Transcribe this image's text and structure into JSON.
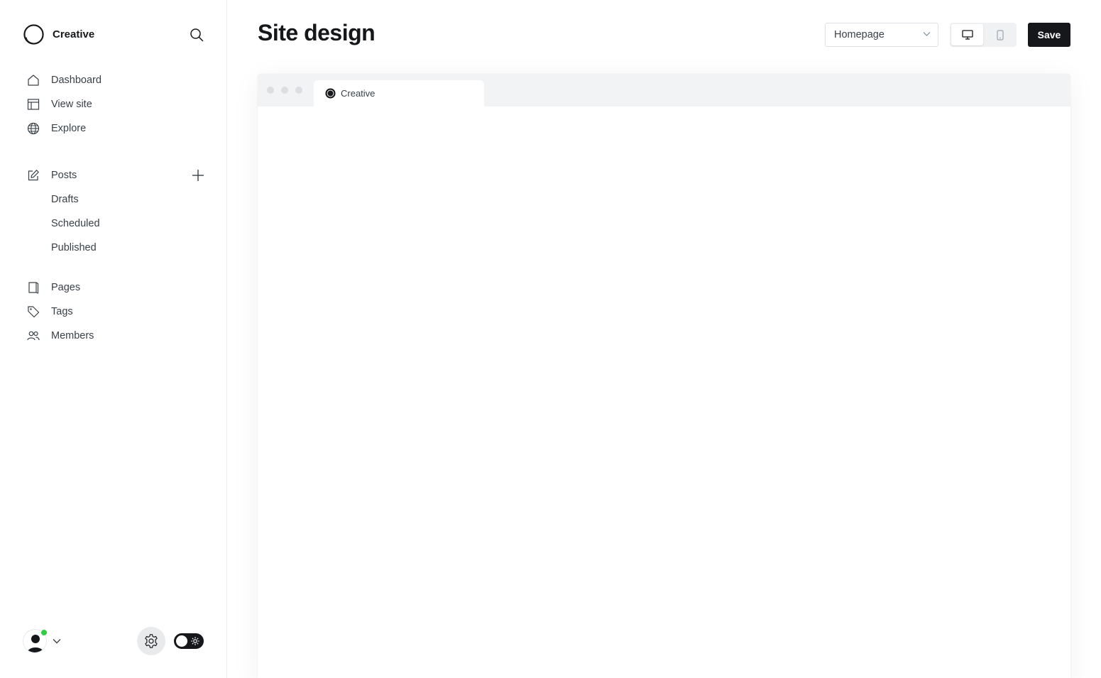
{
  "sidebar": {
    "brand_name": "Creative",
    "primary": [
      {
        "label": "Dashboard",
        "icon": "home-icon"
      },
      {
        "label": "View site",
        "icon": "layout-icon"
      },
      {
        "label": "Explore",
        "icon": "globe-icon"
      }
    ],
    "posts": {
      "label": "Posts",
      "icon": "pencil-square-icon",
      "sub": [
        "Drafts",
        "Scheduled",
        "Published"
      ]
    },
    "secondary": [
      {
        "label": "Pages",
        "icon": "page-icon"
      },
      {
        "label": "Tags",
        "icon": "tag-icon"
      },
      {
        "label": "Members",
        "icon": "members-icon"
      }
    ]
  },
  "main": {
    "title": "Site design",
    "preview_select": {
      "selected": "Homepage"
    },
    "device": {
      "active": "desktop"
    },
    "save_label": "Save"
  },
  "browser": {
    "tab_title": "Creative"
  },
  "colors": {
    "accent_dark": "#15171a",
    "online": "#30cf43",
    "text": "#394047"
  }
}
